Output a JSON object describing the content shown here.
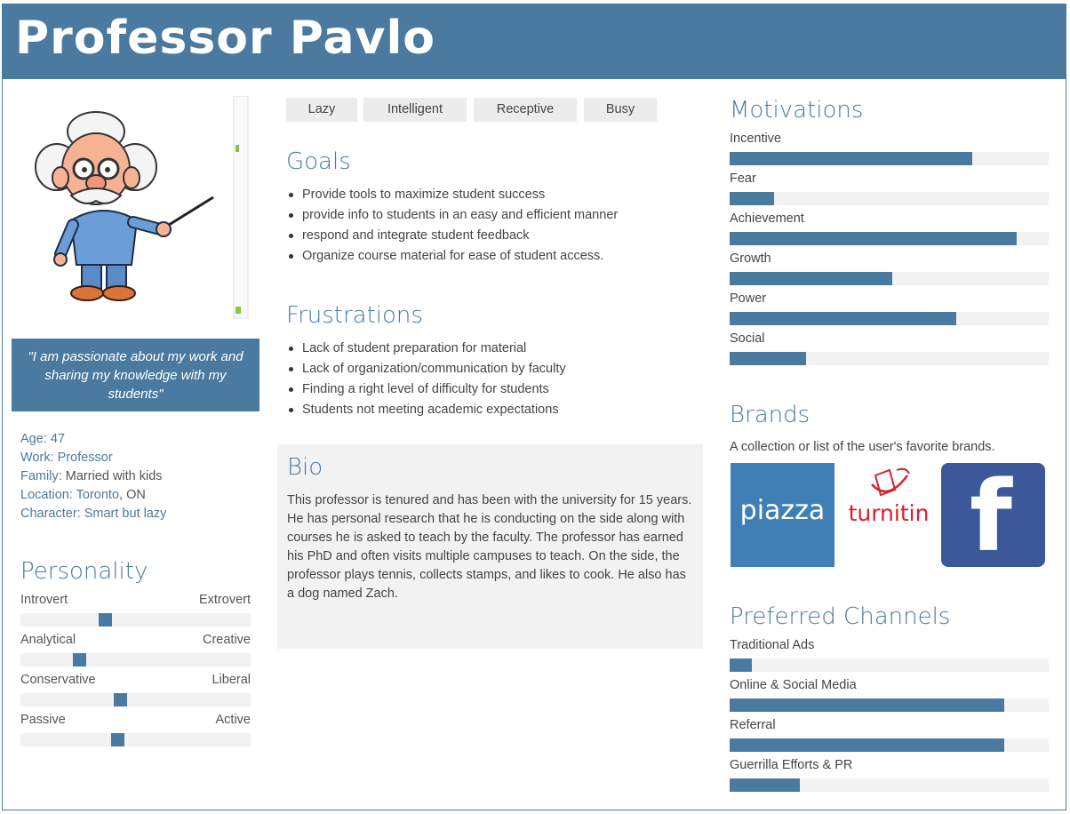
{
  "header": {
    "title": "Professor Pavlo",
    "color": "#4a7aa0"
  },
  "avatar": {
    "icon": "professor-cartoon"
  },
  "quote": "\"I am passionate about my work and sharing my knowledge with my students\"",
  "info": [
    {
      "label": "Age:",
      "value": "47"
    },
    {
      "label": "Work:",
      "value": "Professor"
    },
    {
      "label": "Family:",
      "value": "Married with kids"
    },
    {
      "label": "Location:",
      "value": "Toronto",
      "suffix": ", ON"
    },
    {
      "label": "Character:",
      "value": "Smart but lazy"
    }
  ],
  "personality": {
    "title": "Personality",
    "traits": [
      {
        "left": "Introvert",
        "right": "Extrovert",
        "level": 0.36
      },
      {
        "left": "Analytical",
        "right": "Creative",
        "level": 0.24
      },
      {
        "left": "Conservative",
        "right": "Liberal",
        "level": 0.43
      },
      {
        "left": "Passive",
        "right": "Active",
        "level": 0.42
      }
    ]
  },
  "tags": [
    "Lazy",
    "Intelligent",
    "Receptive",
    "Busy"
  ],
  "goals": {
    "title": "Goals",
    "items": [
      "Provide tools to maximize student success",
      "provide info to students in an easy and efficient manner",
      "respond and integrate student feedback",
      "Organize course material for ease of student access."
    ]
  },
  "frustrations": {
    "title": "Frustrations",
    "items": [
      "Lack of student preparation for material",
      "Lack of organization/communication by faculty",
      "Finding a right level of difficulty for students",
      "Students not meeting academic expectations"
    ]
  },
  "bio": {
    "title": "Bio",
    "text": "This professor is tenured and has been with the university for 15 years. He has personal research that he is conducting on the side along with courses he is asked to teach by the faculty. The professor has earned his PhD and often visits multiple campuses to teach. On the side, the professor plays tennis, collects stamps, and likes to cook. He also has a dog named Zach."
  },
  "motivations": {
    "title": "Motivations",
    "items": [
      {
        "label": "Incentive",
        "level": 0.76
      },
      {
        "label": "Fear",
        "level": 0.14
      },
      {
        "label": "Achievement",
        "level": 0.9
      },
      {
        "label": "Growth",
        "level": 0.51
      },
      {
        "label": "Power",
        "level": 0.71
      },
      {
        "label": "Social",
        "level": 0.24
      }
    ]
  },
  "brands": {
    "title": "Brands",
    "description": "A collection or list of the user's favorite brands.",
    "logos": [
      {
        "name": "piazza",
        "text": "piazza",
        "color": "#3f7fb5"
      },
      {
        "name": "turnitin",
        "text": "turnitin",
        "color": "#d8202e"
      },
      {
        "name": "facebook",
        "text": "f",
        "color": "#3b5998"
      }
    ]
  },
  "channels": {
    "title": "Preferred Channels",
    "items": [
      {
        "label": "Traditional Ads",
        "level": 0.07
      },
      {
        "label": "Online & Social Media",
        "level": 0.86
      },
      {
        "label": "Referral",
        "level": 0.86
      },
      {
        "label": "Guerrilla Efforts & PR",
        "level": 0.22
      }
    ]
  }
}
